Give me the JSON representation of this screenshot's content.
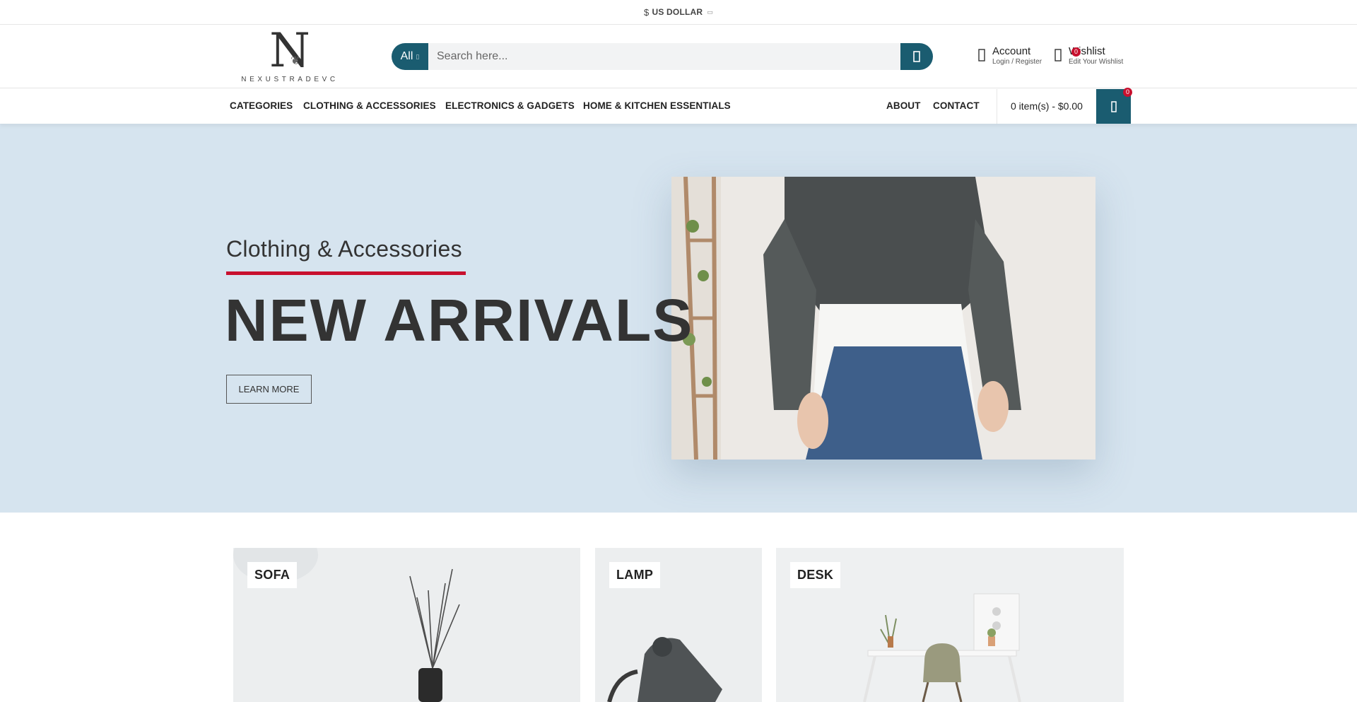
{
  "topbar": {
    "currency_symbol": "$",
    "currency_label": "US DOLLAR"
  },
  "header": {
    "logo_text": "NEXUSTRADEVC",
    "search": {
      "category": "All",
      "placeholder": "Search here..."
    },
    "account": {
      "title": "Account",
      "subtitle": "Login / Register"
    },
    "wishlist": {
      "title": "Wishlist",
      "subtitle": "Edit Your Wishlist",
      "count": "0"
    }
  },
  "nav": {
    "items": [
      "CATEGORIES",
      "CLOTHING & ACCESSORIES",
      "ELECTRONICS & GADGETS",
      "HOME & KITCHEN ESSENTIALS"
    ],
    "right_items": [
      "ABOUT",
      "CONTACT"
    ],
    "cart_summary": "0 item(s) - $0.00",
    "cart_count": "0"
  },
  "hero": {
    "subtitle": "Clothing & Accessories",
    "title": "NEW ARRIVALS",
    "button": "LEARN MORE"
  },
  "categories": [
    {
      "label": "SOFA"
    },
    {
      "label": "LAMP"
    },
    {
      "label": "DESK"
    }
  ],
  "colors": {
    "brand": "#1a5c70",
    "accent": "#c8102e",
    "hero_bg": "#d6e4ef"
  }
}
